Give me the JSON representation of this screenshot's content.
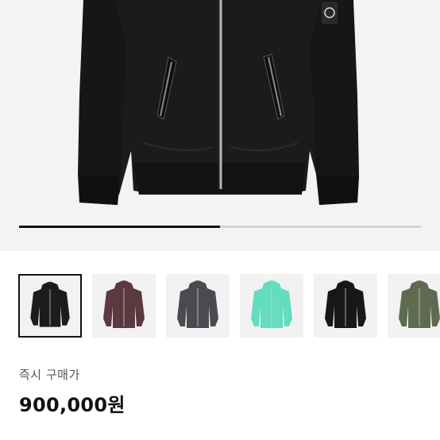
{
  "gallery": {
    "current_index": 0,
    "progress_fraction": 0.5,
    "thumbnails": [
      {
        "color": "#1c1c1c",
        "selected": true
      },
      {
        "color": "#5a3940",
        "selected": false
      },
      {
        "color": "#4a4b50",
        "selected": false
      },
      {
        "color": "#63dcc0",
        "selected": false
      },
      {
        "color": "#171717",
        "selected": false
      },
      {
        "color": "#5e6b4f",
        "selected": false
      }
    ]
  },
  "purchase": {
    "label": "즉시 구매가",
    "price": "900,000원"
  },
  "colors": {
    "hero_bg": "#f3f3f3",
    "jacket_main": "#1b1b1d",
    "accent_text": "#111111"
  }
}
